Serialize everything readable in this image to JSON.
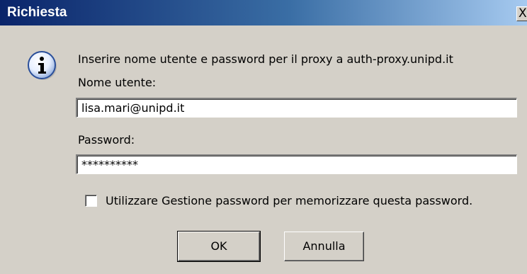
{
  "window": {
    "title": "Richiesta",
    "close_glyph": "X"
  },
  "dialog": {
    "icon": "info-icon",
    "message": "Inserire nome utente e password per il proxy a auth-proxy.unipd.it",
    "username_label": "Nome utente:",
    "username_value": "lisa.mari@unipd.it",
    "password_label": "Password:",
    "password_value": "**********",
    "remember_checked": false,
    "remember_label": "Utilizzare Gestione password per memorizzare questa password.",
    "ok_label": "OK",
    "cancel_label": "Annulla"
  }
}
